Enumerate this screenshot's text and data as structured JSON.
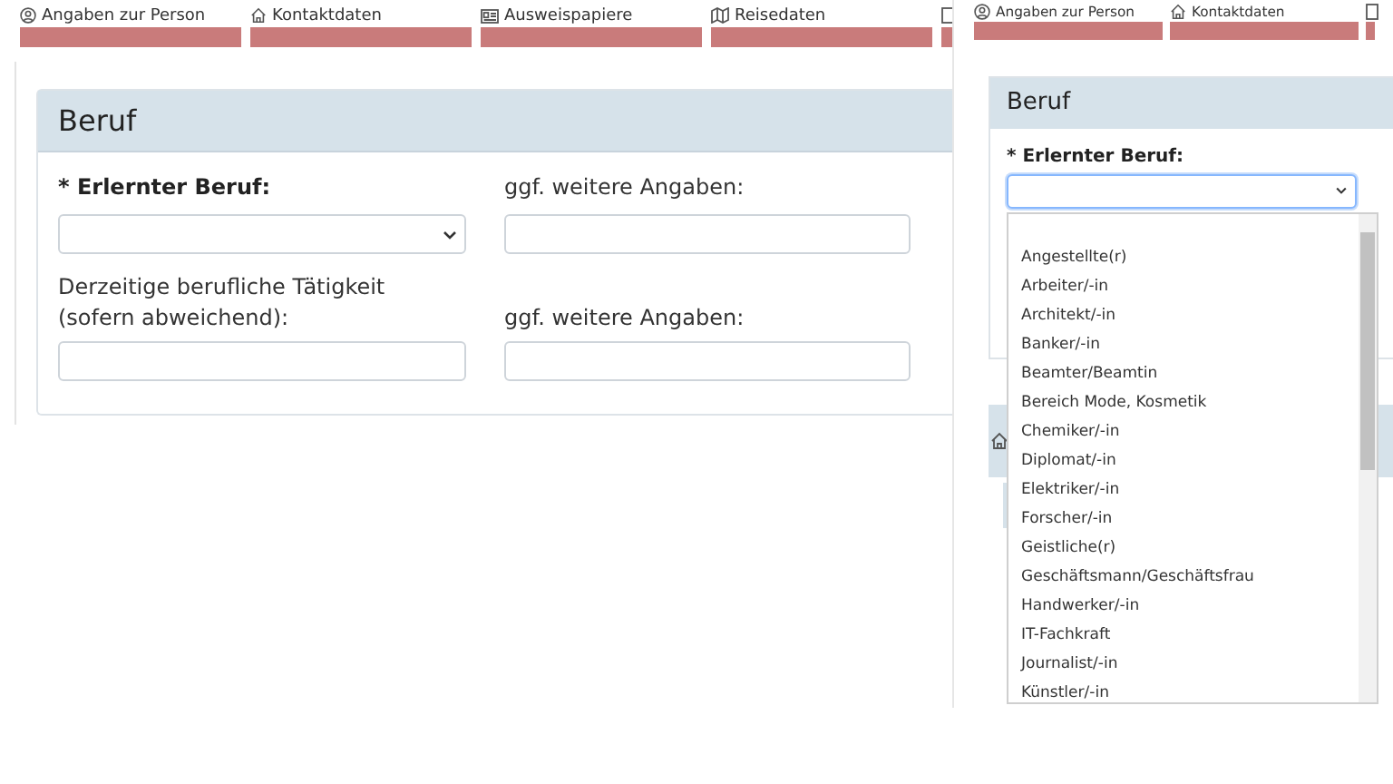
{
  "left_view": {
    "tabs": [
      {
        "kind": "person",
        "label": "Angaben zur Person"
      },
      {
        "kind": "house",
        "label": "Kontaktdaten"
      },
      {
        "kind": "card",
        "label": "Ausweispapiere"
      },
      {
        "kind": "map",
        "label": "Reisedaten"
      },
      {
        "kind": "cut"
      }
    ],
    "card": {
      "title": "Beruf",
      "fields": [
        {
          "label": "* Erlernter Beruf:",
          "required": true,
          "kind": "select"
        },
        {
          "label": "ggf. weitere Angaben:",
          "required": false,
          "kind": "input"
        },
        {
          "label": "Derzeitige berufliche Tätigkeit (sofern abweichend):",
          "required": false,
          "kind": "input"
        },
        {
          "label": "ggf. weitere Angaben:",
          "required": false,
          "kind": "input"
        }
      ]
    }
  },
  "right_view": {
    "tabs": [
      {
        "kind": "person",
        "label": "Angaben zur Person"
      },
      {
        "kind": "house",
        "label": "Kontaktdaten"
      },
      {
        "kind": "cut"
      }
    ],
    "card": {
      "title": "Beruf",
      "field": {
        "label": "* Erlernter Beruf:",
        "required": true,
        "focused": true
      }
    },
    "dropdown": {
      "options": [
        "Angestellte(r)",
        "Arbeiter/-in",
        "Architekt/-in",
        "Banker/-in",
        "Beamter/Beamtin",
        "Bereich Mode, Kosmetik",
        "Chemiker/-in",
        "Diplomat/-in",
        "Elektriker/-in",
        "Forscher/-in",
        "Geistliche(r)",
        "Geschäftsmann/Geschäftsfrau",
        "Handwerker/-in",
        "IT-Fachkraft",
        "Journalist/-in",
        "Künstler/-in"
      ]
    }
  }
}
